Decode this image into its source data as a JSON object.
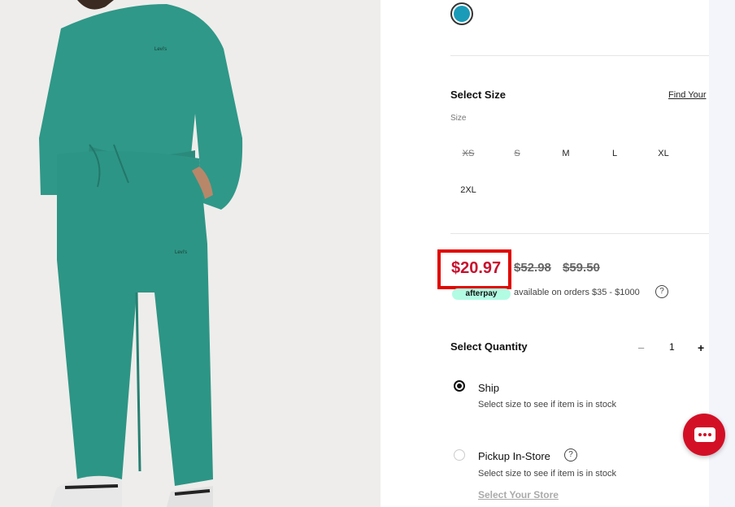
{
  "product": {
    "color_swatch": "#1a9bb8",
    "sweat_color": "#2e9a8a"
  },
  "size": {
    "title": "Select Size",
    "find_link": "Find Your",
    "caption": "Size",
    "options": [
      {
        "label": "XS",
        "available": false
      },
      {
        "label": "S",
        "available": false
      },
      {
        "label": "M",
        "available": true
      },
      {
        "label": "L",
        "available": true
      },
      {
        "label": "XL",
        "available": true
      },
      {
        "label": "2XL",
        "available": true
      }
    ]
  },
  "price": {
    "current": "$20.97",
    "was1": "$52.98",
    "was2": "$59.50",
    "afterpay_badge": "afterpay",
    "afterpay_text": "available on orders $35 - $1000",
    "help": "?"
  },
  "quantity": {
    "title": "Select Quantity",
    "minus": "–",
    "value": "1",
    "plus": "+"
  },
  "fulfillment": {
    "ship_label": "Ship",
    "ship_sub": "Select size to see if item is in stock",
    "pickup_label": "Pickup In-Store",
    "pickup_sub": "Select size to see if item is in stock",
    "store_link": "Select Your Store"
  },
  "colors": {
    "sale_red": "#c8102e",
    "highlight_red": "#e10600",
    "chat_red": "#d30f26"
  }
}
